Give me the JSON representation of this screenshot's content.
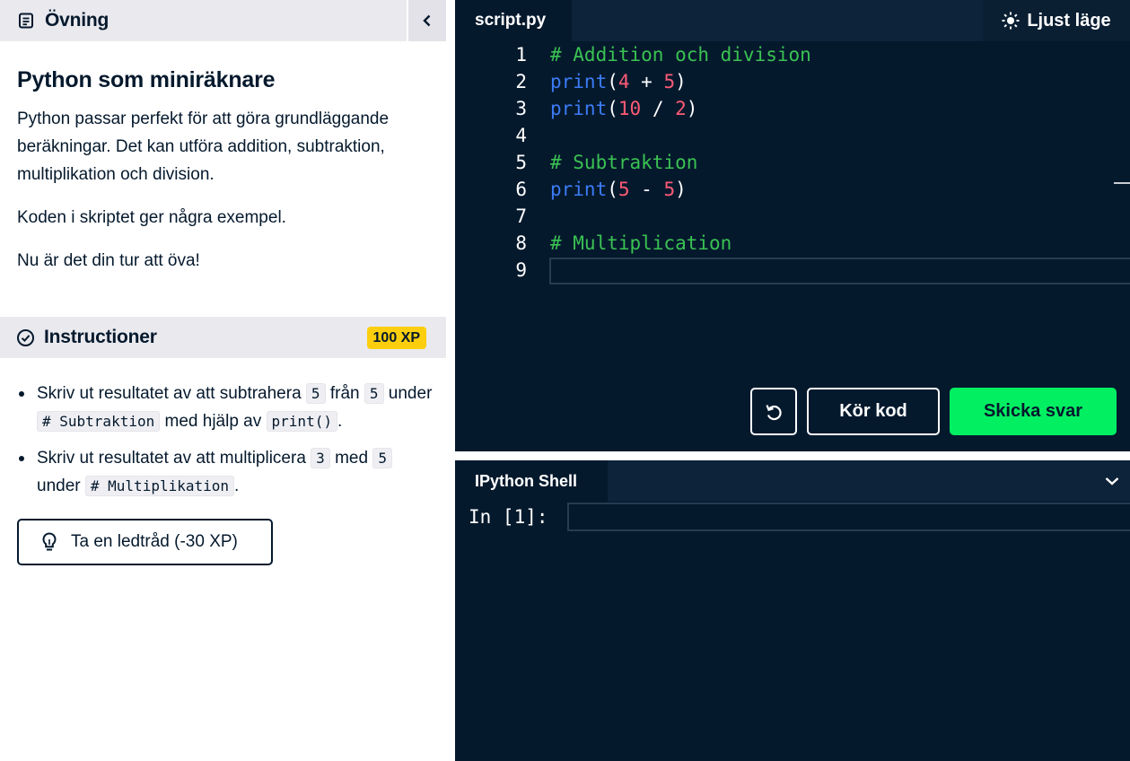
{
  "exercise": {
    "header": "Övning",
    "title": "Python som miniräknare",
    "paragraphs": [
      "Python passar perfekt för att göra grundläggande beräkningar. Det kan utföra addition, subtraktion, multiplikation och division.",
      "Koden i skriptet ger några exempel.",
      "Nu är det din tur att öva!"
    ]
  },
  "instructions": {
    "header": "Instructioner",
    "xp": "100 XP",
    "items": [
      {
        "t1": "Skriv ut resultatet av att subtrahera",
        "c1": "5",
        "t2": "från",
        "c2": "5",
        "t3": "under",
        "c3": "# Subtraktion",
        "t4": "med hjälp av",
        "c4": "print()",
        "t5": "."
      },
      {
        "t1": "Skriv ut resultatet av att multiplicera",
        "c1": "3",
        "t2": "med",
        "c2": "5",
        "t3": "under",
        "c3": "# Multiplikation",
        "t4": "."
      }
    ],
    "hint_label": "Ta en ledtråd (-30 XP)"
  },
  "editor": {
    "tab": "script.py",
    "light_mode": "Ljust läge",
    "line_numbers": [
      "1",
      "2",
      "3",
      "4",
      "5",
      "6",
      "7",
      "8",
      "9"
    ],
    "lines": {
      "l1": "# Addition och division",
      "l2_fn": "print",
      "l2_a": "4",
      "l2_op": " + ",
      "l2_b": "5",
      "l3_fn": "print",
      "l3_a": "10",
      "l3_op": " / ",
      "l3_b": "2",
      "l5": "# Subtraktion",
      "l6_fn": "print",
      "l6_a": "5",
      "l6_op": " - ",
      "l6_b": "5",
      "l8": "# Multiplication"
    },
    "run_label": "Kör kod",
    "submit_label": "Skicka svar"
  },
  "shell": {
    "tab": "IPython Shell",
    "prompt": "In [1]:"
  },
  "icons": {
    "exercise": "document-icon",
    "collapse": "chevron-left-icon",
    "instructions": "check-circle-icon",
    "hint": "lightbulb-icon",
    "light_mode": "sun-icon",
    "reset": "undo-icon",
    "shell_collapse": "chevron-down-icon"
  },
  "colors": {
    "accent_green": "#03ef62",
    "xp_yellow": "#fcce0d",
    "editor_bg": "#05192d",
    "comment": "#3ac252",
    "function": "#3b7cf5",
    "number": "#ff5b76"
  }
}
